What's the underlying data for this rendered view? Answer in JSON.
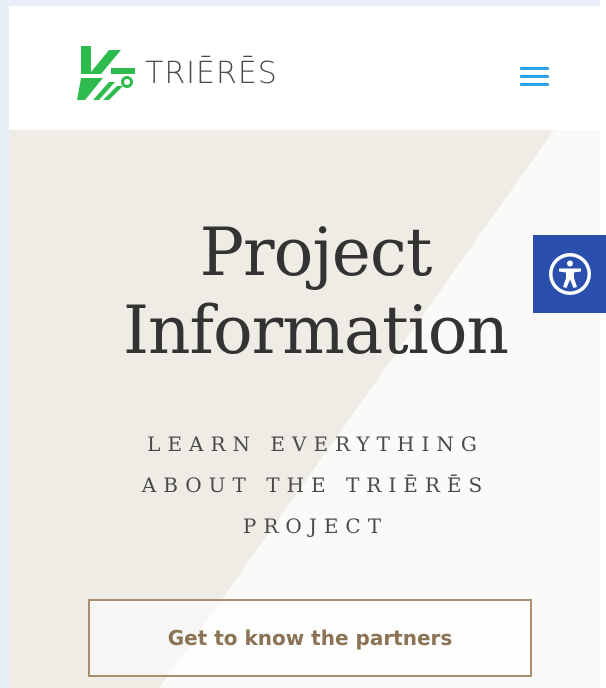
{
  "header": {
    "logo_text": "TRIĒRĒS",
    "logo_icon": "trieres-logo-icon",
    "menu_icon": "hamburger-menu-icon"
  },
  "hero": {
    "title_line1": "Project",
    "title_line2": "Information",
    "subtitle_line1": "LEARN EVERYTHING",
    "subtitle_line2": "ABOUT THE TRIĒRĒS",
    "subtitle_line3": "PROJECT",
    "cta_label": "Get to know the partners"
  },
  "accessibility": {
    "icon": "accessibility-icon"
  },
  "colors": {
    "brand_green": "#2dbb4e",
    "menu_blue": "#2ea3f2",
    "accessibility_blue": "#2b4fad",
    "cta_border": "#a8906e",
    "cta_text": "#8b7355"
  }
}
